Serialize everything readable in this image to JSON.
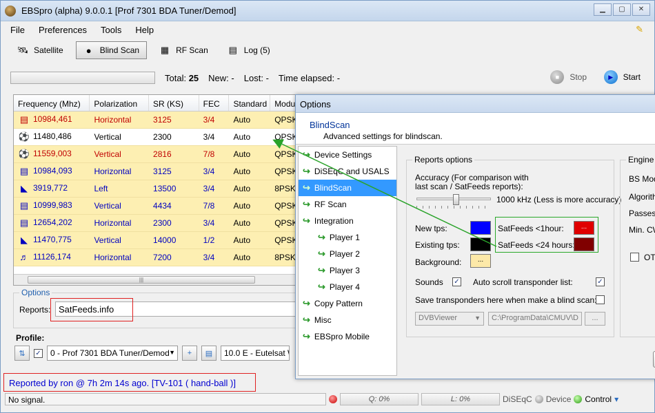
{
  "window": {
    "title": "EBSpro (alpha) 9.0.0.1 [Prof 7301 BDA Tuner/Demod]",
    "min": "▁",
    "max": "▢",
    "close": "✕"
  },
  "menu": [
    "File",
    "Preferences",
    "Tools",
    "Help"
  ],
  "toolbar": {
    "satellite": "Satellite",
    "blind_scan": "Blind Scan",
    "rf_scan": "RF Scan",
    "log": "Log (5)"
  },
  "scan_status": {
    "total_label": "Total:",
    "total_value": "25",
    "new_label": "New:",
    "new_value": "-",
    "lost_label": "Lost:",
    "lost_value": "-",
    "elapsed_label": "Time elapsed:",
    "elapsed_value": "-",
    "stop": "Stop",
    "start": "Start"
  },
  "table": {
    "headers": [
      "Frequency (Mhz)",
      "Polarization",
      "SR (KS)",
      "FEC",
      "Standard",
      "Modu"
    ],
    "rows": [
      {
        "freq": "10984,461",
        "pol": "Horizontal",
        "sr": "3125",
        "fec": "3/4",
        "std": "Auto",
        "mod": "QPSK",
        "color": "red",
        "icon": "▤"
      },
      {
        "freq": "11480,486",
        "pol": "Vertical",
        "sr": "2300",
        "fec": "3/4",
        "std": "Auto",
        "mod": "QPSK",
        "color": "black",
        "icon": "⚽"
      },
      {
        "freq": "11559,003",
        "pol": "Vertical",
        "sr": "2816",
        "fec": "7/8",
        "std": "Auto",
        "mod": "QPSK",
        "color": "red",
        "icon": "⚽"
      },
      {
        "freq": "10984,093",
        "pol": "Horizontal",
        "sr": "3125",
        "fec": "3/4",
        "std": "Auto",
        "mod": "QPSK",
        "color": "blue",
        "icon": "▤"
      },
      {
        "freq": "3919,772",
        "pol": "Left",
        "sr": "13500",
        "fec": "3/4",
        "std": "Auto",
        "mod": "8PSK",
        "color": "blue",
        "icon": "◣"
      },
      {
        "freq": "10999,983",
        "pol": "Vertical",
        "sr": "4434",
        "fec": "7/8",
        "std": "Auto",
        "mod": "QPSK",
        "color": "blue",
        "icon": "▤"
      },
      {
        "freq": "12654,202",
        "pol": "Horizontal",
        "sr": "2300",
        "fec": "3/4",
        "std": "Auto",
        "mod": "QPSK",
        "color": "blue",
        "icon": "▤"
      },
      {
        "freq": "11470,775",
        "pol": "Vertical",
        "sr": "14000",
        "fec": "1/2",
        "std": "Auto",
        "mod": "QPSK",
        "color": "blue",
        "icon": "◣"
      },
      {
        "freq": "11126,174",
        "pol": "Horizontal",
        "sr": "7200",
        "fec": "3/4",
        "std": "Auto",
        "mod": "8PSK",
        "color": "blue",
        "icon": "♬"
      }
    ]
  },
  "options_panel": {
    "legend": "Options",
    "reports_label": "Reports:",
    "reports_value": "SatFeeds.info"
  },
  "profile": {
    "label": "Profile:",
    "tuner": "0 - Prof 7301 BDA Tuner/Demod",
    "satellite": "10.0 E - Eutelsat W"
  },
  "reported_text": "Reported by ron @ 7h 2m 14s  ago. [TV-101 ( hand-ball )]",
  "statusbar": {
    "signal": "No signal.",
    "q": "Q: 0%",
    "l": "L: 0%",
    "diseqc": "DiSEqC",
    "device": "Device",
    "control": "Control"
  },
  "dialog": {
    "title": "Options",
    "heading": "BlindScan",
    "subheading": "Advanced settings for blindscan.",
    "nav": [
      {
        "label": "Device Settings",
        "sub": false
      },
      {
        "label": "DiSEqC and USALS",
        "sub": false
      },
      {
        "label": "BlindScan",
        "sub": false,
        "selected": true
      },
      {
        "label": "RF Scan",
        "sub": false
      },
      {
        "label": "Integration",
        "sub": false
      },
      {
        "label": "Player 1",
        "sub": true
      },
      {
        "label": "Player 2",
        "sub": true
      },
      {
        "label": "Player 3",
        "sub": true
      },
      {
        "label": "Player 4",
        "sub": true
      },
      {
        "label": "Copy Pattern",
        "sub": false
      },
      {
        "label": "Misc",
        "sub": false
      },
      {
        "label": "EBSpro Mobile",
        "sub": false
      }
    ],
    "reports": {
      "legend": "Reports options",
      "accuracy_line1": "Accuracy (For comparison with",
      "accuracy_line2": "last scan / SatFeeds reports):",
      "accuracy_value": "1000 kHz (Less is more accuracy)",
      "new_tps": "New tps:",
      "existing_tps": "Existing tps:",
      "background": "Background:",
      "satfeeds_1h": "SatFeeds <1hour:",
      "satfeeds_24h": "SatFeeds <24 hours:",
      "swatch_btn": "...",
      "sounds": "Sounds",
      "auto_scroll": "Auto scroll transponder list:",
      "save_here": "Save transponders here when make a blind scan:",
      "app_combo": "DVBViewer",
      "path": "C:\\ProgramData\\CMUV\\D",
      "browse": "..."
    },
    "engine": {
      "legend": "Engine",
      "bs_mode": "BS Mod",
      "algorithm": "Algorith",
      "passes": "Passes:",
      "min_cw": "Min. CW",
      "oth": "OTH"
    },
    "colors": {
      "new": "#0000ff",
      "existing": "#000000",
      "background": "#fde9a8",
      "satfeeds_1h": "#e00000",
      "satfeeds_24h": "#800000"
    }
  }
}
